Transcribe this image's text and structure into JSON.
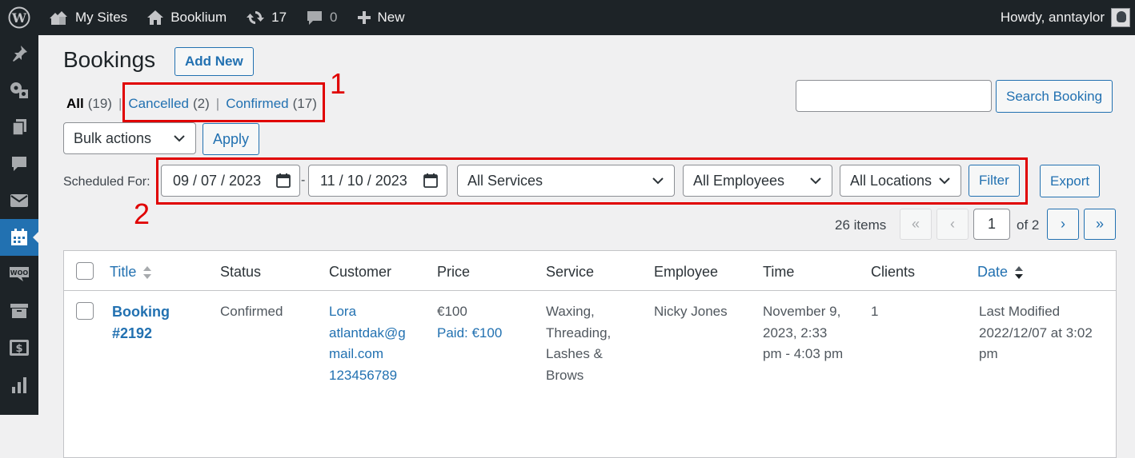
{
  "adminbar": {
    "my_sites": "My Sites",
    "site_name": "Booklium",
    "updates_count": "17",
    "comments_count": "0",
    "new_label": "New",
    "howdy": "Howdy, anntaylor"
  },
  "page": {
    "title": "Bookings",
    "add_new": "Add New"
  },
  "views": {
    "all_label": "All",
    "all_count": "(19)",
    "cancelled_label": "Cancelled",
    "cancelled_count": "(2)",
    "confirmed_label": "Confirmed",
    "confirmed_count": "(17)",
    "separator": "|"
  },
  "annotations": {
    "one": "1",
    "two": "2"
  },
  "search": {
    "value": "",
    "button": "Search Booking"
  },
  "bulk": {
    "selected": "Bulk actions",
    "apply": "Apply"
  },
  "filters": {
    "scheduled_for": "Scheduled For:",
    "date_from": "09 / 07 / 2023",
    "dash": "-",
    "date_to": "11 / 10 / 2023",
    "services": "All Services",
    "employees": "All Employees",
    "locations": "All Locations",
    "filter_button": "Filter",
    "export_button": "Export"
  },
  "pagination": {
    "items": "26 items",
    "first": "«",
    "prev": "‹",
    "current": "1",
    "of": "of 2",
    "next": "›",
    "last": "»"
  },
  "table": {
    "columns": {
      "title": "Title",
      "status": "Status",
      "customer": "Customer",
      "price": "Price",
      "service": "Service",
      "employee": "Employee",
      "time": "Time",
      "clients": "Clients",
      "date": "Date"
    },
    "rows": [
      {
        "title_line1": "Booking",
        "title_line2": "#2192",
        "status": "Confirmed",
        "customer_line1": "Lora",
        "customer_line2": "atlantdak@g",
        "customer_line3": "mail.com",
        "customer_line4": "123456789",
        "price": "€100",
        "paid": "Paid: €100",
        "service_line1": "Waxing,",
        "service_line2": "Threading,",
        "service_line3": "Lashes &",
        "service_line4": "Brows",
        "employee": "Nicky Jones",
        "time_line1": "November 9,",
        "time_line2": "2023, 2:33",
        "time_line3": "pm - 4:03 pm",
        "clients": "1",
        "date_line1": "Last Modified",
        "date_line2": "2022/12/07 at 3:02",
        "date_line3": "pm"
      }
    ]
  },
  "colors": {
    "admin_dark": "#1d2327",
    "accent": "#2271b1",
    "annotation": "#e00000"
  },
  "icons": {
    "wp": "wordpress-logo-icon",
    "sites": "my-sites-icon",
    "home": "home-icon",
    "updates": "updates-icon",
    "comments": "comment-icon",
    "new": "plus-icon",
    "calendar": "calendar-icon",
    "chevron": "chevron-down-icon"
  }
}
